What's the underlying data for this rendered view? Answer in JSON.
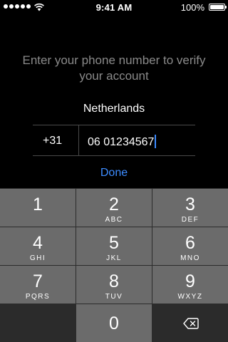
{
  "status_bar": {
    "signal_bars": 5,
    "wifi_icon": "wifi-icon",
    "time": "9:41 AM",
    "battery_percent": "100%",
    "battery_level": 1.0
  },
  "form": {
    "prompt": "Enter your phone number to verify your account",
    "country": "Netherlands",
    "country_code": "+31",
    "phone_number": "06 01234567",
    "done_label": "Done"
  },
  "keypad": {
    "keys": [
      {
        "digit": "1",
        "letters": ""
      },
      {
        "digit": "2",
        "letters": "ABC"
      },
      {
        "digit": "3",
        "letters": "DEF"
      },
      {
        "digit": "4",
        "letters": "GHI"
      },
      {
        "digit": "5",
        "letters": "JKL"
      },
      {
        "digit": "6",
        "letters": "MNO"
      },
      {
        "digit": "7",
        "letters": "PQRS"
      },
      {
        "digit": "8",
        "letters": "TUV"
      },
      {
        "digit": "9",
        "letters": "WXYZ"
      },
      {
        "digit": "0",
        "letters": ""
      }
    ],
    "delete_icon": "backspace-icon"
  },
  "colors": {
    "background": "#000000",
    "accent": "#3d8cff",
    "prompt_text": "#8a8a8a",
    "key": "#6b6b6b",
    "keypad_background": "#2b2b2b"
  }
}
